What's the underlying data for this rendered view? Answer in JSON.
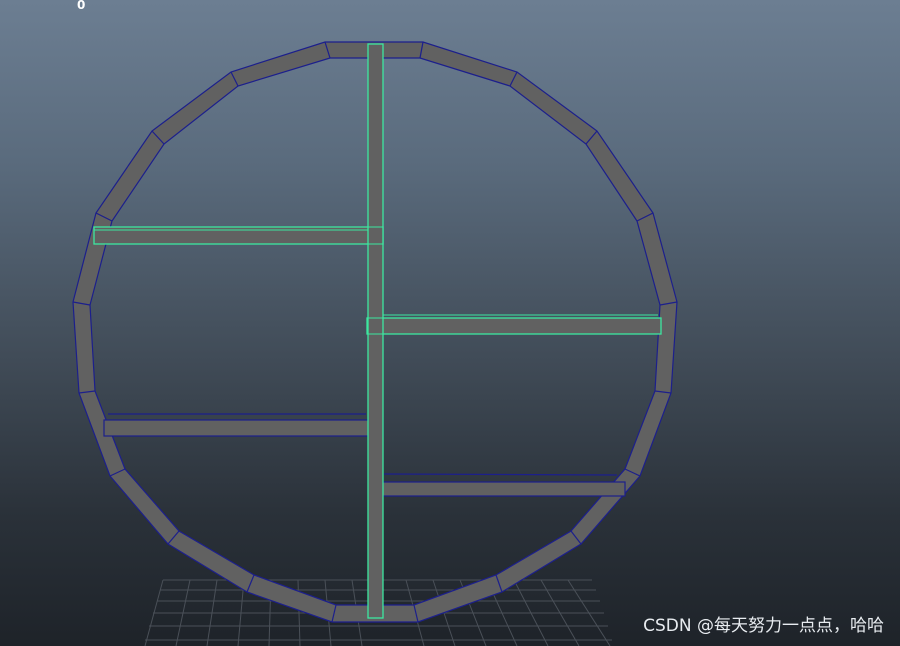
{
  "viewport": {
    "frame_counter": "0",
    "colors": {
      "background_top": "#6c7e92",
      "background_bottom": "#1e2329",
      "grid": "#4a5058",
      "wireframe": "#1c1f8c",
      "face": "#616161",
      "selection": "#3ce8a0"
    }
  },
  "watermark": {
    "text": "CSDN @每天努力一点点，哈哈"
  }
}
